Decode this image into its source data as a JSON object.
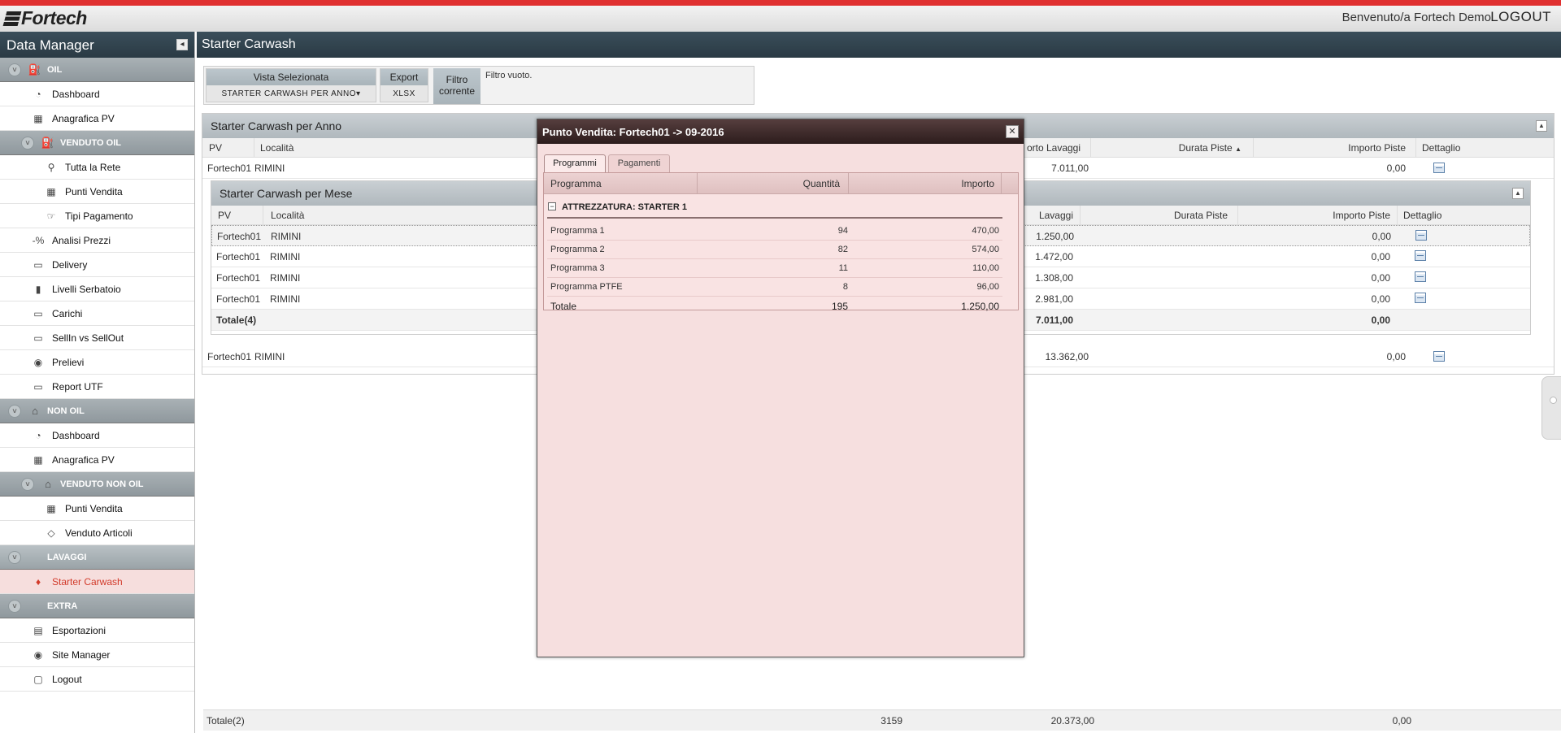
{
  "header": {
    "logo": "Fortech",
    "welcome": "Benvenuto/a Fortech Demo",
    "logout": "LOGOUT"
  },
  "sidebar": {
    "title": "Data Manager",
    "oil": "OIL",
    "oil_items": [
      "Dashboard",
      "Anagrafica PV"
    ],
    "venduto_oil": "VENDUTO OIL",
    "venduto_oil_items": [
      "Tutta la Rete",
      "Punti Vendita",
      "Tipi Pagamento"
    ],
    "oil_items2": [
      "Analisi Prezzi",
      "Delivery",
      "Livelli Serbatoio",
      "Carichi",
      "SellIn vs SellOut",
      "Prelievi",
      "Report UTF"
    ],
    "non_oil": "NON OIL",
    "non_oil_items": [
      "Dashboard",
      "Anagrafica PV"
    ],
    "venduto_non_oil": "VENDUTO NON OIL",
    "venduto_non_oil_items": [
      "Punti Vendita",
      "Venduto Articoli"
    ],
    "lavaggi": "LAVAGGI",
    "lavaggi_items": [
      "Starter Carwash"
    ],
    "extra": "EXTRA",
    "extra_items": [
      "Esportazioni",
      "Site Manager",
      "Logout"
    ]
  },
  "main": {
    "title": "Starter Carwash",
    "filters": {
      "vista_label": "Vista Selezionata",
      "vista_value": "STARTER CARWASH PER ANNO",
      "export_label": "Export",
      "export_value": "XLSX",
      "filtro_label_1": "Filtro",
      "filtro_label_2": "corrente",
      "filtro_value": "Filtro vuoto."
    },
    "anno_panel": {
      "title": "Starter Carwash per Anno",
      "columns": {
        "pv": "PV",
        "localita": "Località",
        "importo_lavaggi": "orto Lavaggi",
        "durata_piste": "Durata Piste",
        "importo_piste": "Importo Piste",
        "dettaglio": "Dettaglio"
      },
      "rows": [
        {
          "pv": "Fortech01",
          "localita": "RIMINI",
          "importo_lavaggi": "7.011,00",
          "importo_piste": "0,00"
        },
        {
          "pv": "Fortech01",
          "localita": "RIMINI",
          "importo_lavaggi": "13.362,00",
          "importo_piste": "0,00"
        }
      ]
    },
    "mese_panel": {
      "title": "Starter Carwash per Mese",
      "columns": {
        "pv": "PV",
        "localita": "Località",
        "importo_lavaggi": "Lavaggi",
        "durata_piste": "Durata Piste",
        "importo_piste": "Importo Piste",
        "dettaglio": "Dettaglio"
      },
      "rows": [
        {
          "pv": "Fortech01",
          "localita": "RIMINI",
          "importo_lavaggi": "1.250,00",
          "importo_piste": "0,00"
        },
        {
          "pv": "Fortech01",
          "localita": "RIMINI",
          "importo_lavaggi": "1.472,00",
          "importo_piste": "0,00"
        },
        {
          "pv": "Fortech01",
          "localita": "RIMINI",
          "importo_lavaggi": "1.308,00",
          "importo_piste": "0,00"
        },
        {
          "pv": "Fortech01",
          "localita": "RIMINI",
          "importo_lavaggi": "2.981,00",
          "importo_piste": "0,00"
        }
      ],
      "total": {
        "label": "Totale(4)",
        "importo_lavaggi": "7.011,00",
        "importo_piste": "0,00"
      }
    },
    "footer_total": {
      "label": "Totale(2)",
      "quantita": "3159",
      "importo_lavaggi": "20.373,00",
      "importo_piste": "0,00"
    }
  },
  "modal": {
    "title": "Punto Vendita: Fortech01 -> 09-2016",
    "tabs": [
      "Programmi",
      "Pagamenti"
    ],
    "columns": {
      "programma": "Programma",
      "quantita": "Quantità",
      "importo": "Importo"
    },
    "group": "ATTREZZATURA: STARTER 1",
    "rows": [
      {
        "programma": "Programma 1",
        "quantita": "94",
        "importo": "470,00"
      },
      {
        "programma": "Programma 2",
        "quantita": "82",
        "importo": "574,00"
      },
      {
        "programma": "Programma 3",
        "quantita": "11",
        "importo": "110,00"
      },
      {
        "programma": "Programma PTFE",
        "quantita": "8",
        "importo": "96,00"
      }
    ],
    "total": {
      "label": "Totale",
      "quantita": "195",
      "importo": "1.250,00"
    }
  },
  "colors": {
    "accent_red": "#e03030",
    "active_item": "#d23a2a",
    "header_dark": "#2a3a44",
    "modal_bg": "#f6dfdf",
    "modal_title": "#2c1c1c"
  }
}
